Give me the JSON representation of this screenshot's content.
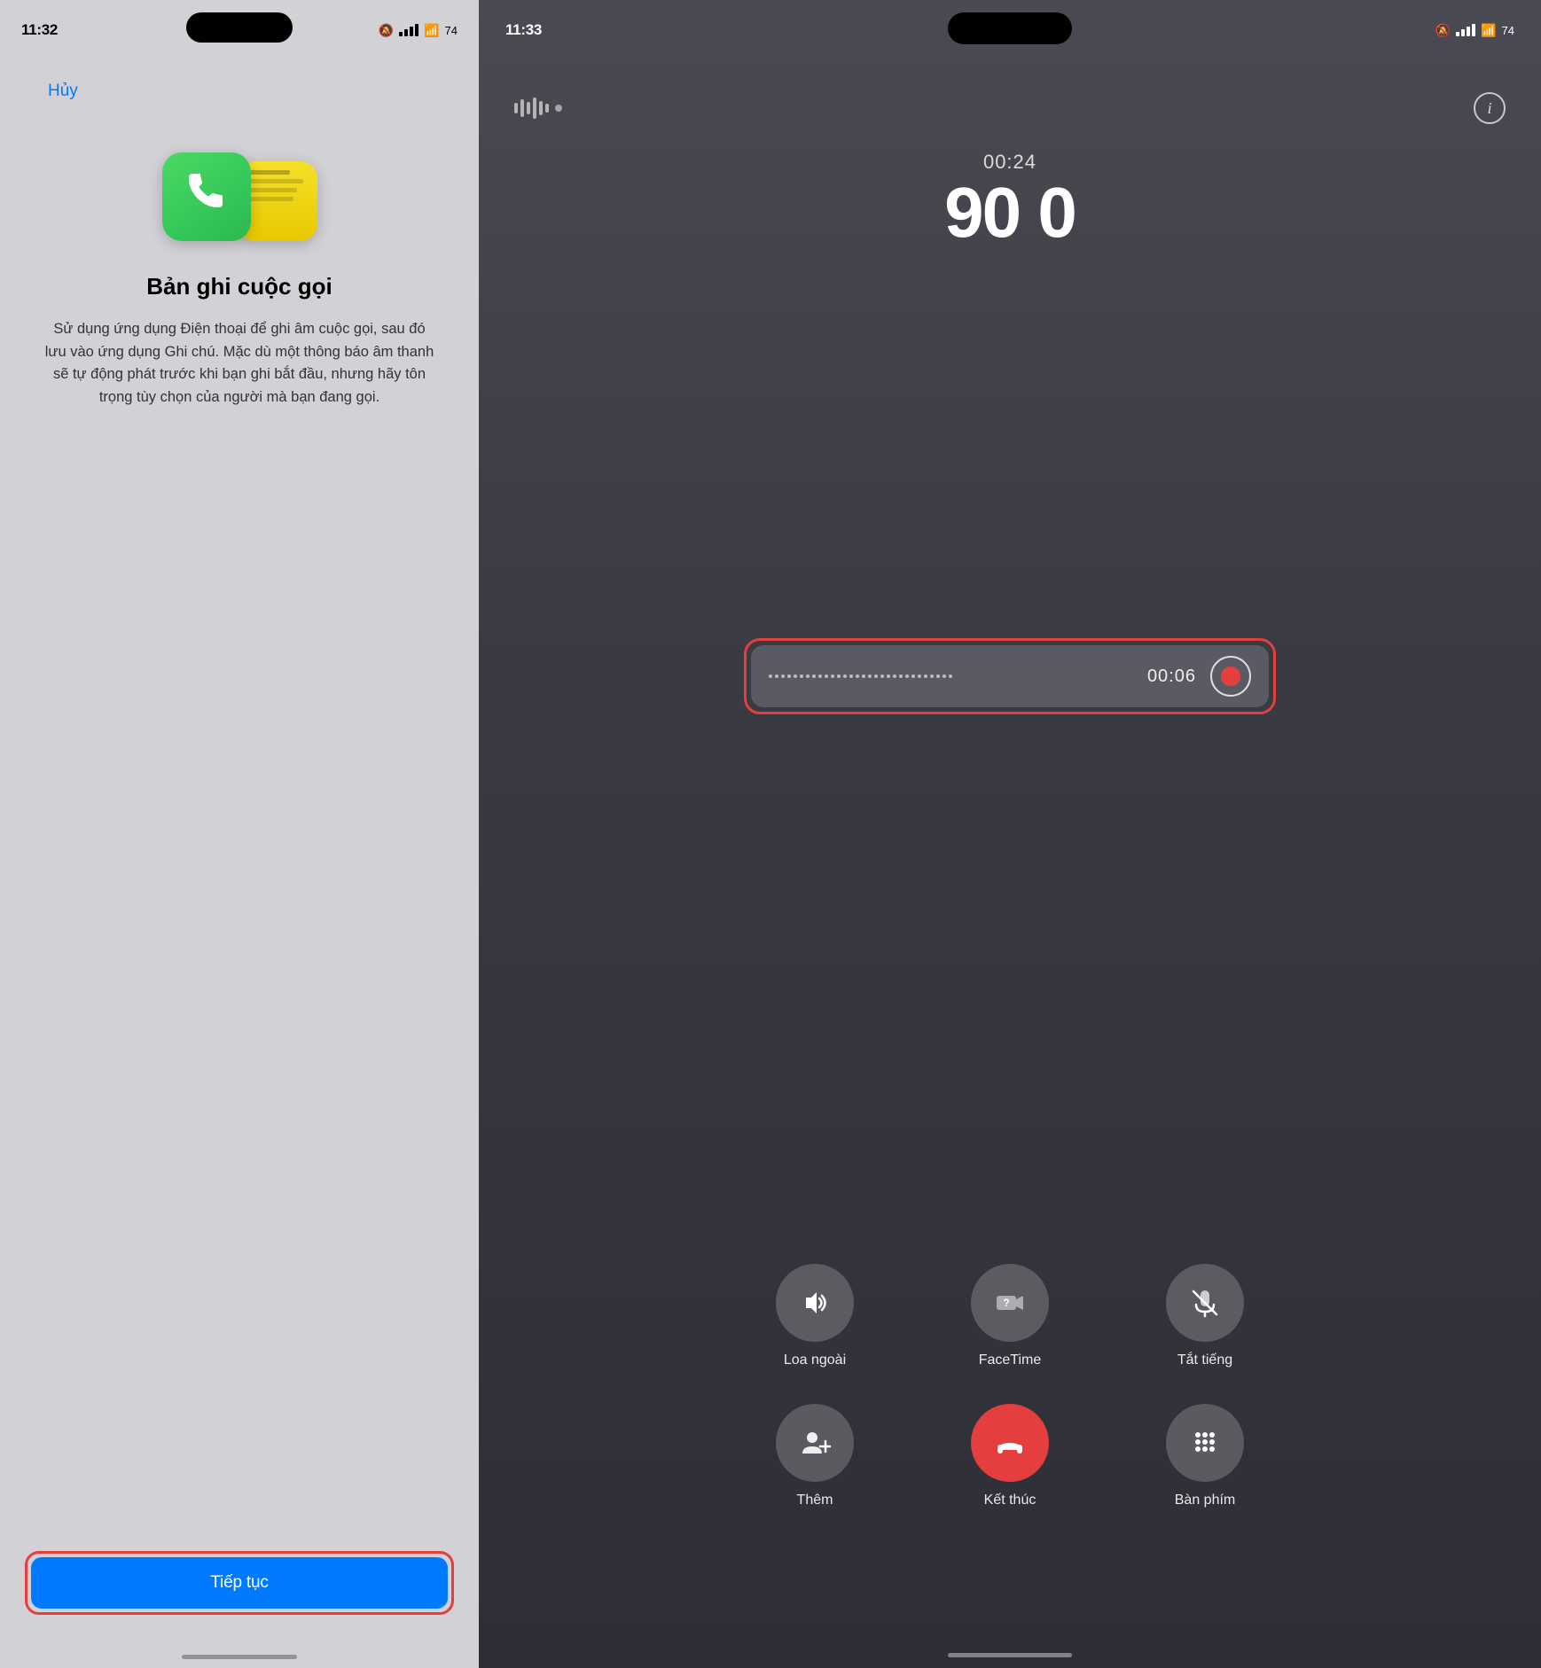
{
  "left": {
    "statusBar": {
      "time": "11:32",
      "bellSlash": "🔕",
      "battery": "74"
    },
    "cancelButton": "Hủy",
    "title": "Bản ghi cuộc gọi",
    "description": "Sử dụng ứng dụng Điện thoại để ghi âm cuộc gọi, sau đó lưu vào ứng dụng Ghi chú. Mặc dù một thông báo âm thanh sẽ tự động phát trước khi bạn ghi bắt đầu, nhưng hãy tôn trọng tùy chọn của người mà bạn đang gọi.",
    "continueButton": "Tiếp tục"
  },
  "right": {
    "statusBar": {
      "time": "11:33",
      "bellSlash": "🔕",
      "battery": "74"
    },
    "callDuration": "00:24",
    "contactName": "90 0",
    "recordingTime": "00:06",
    "controls": [
      {
        "label": "Loa ngoài",
        "icon": "speaker"
      },
      {
        "label": "FaceTime",
        "icon": "facetime"
      },
      {
        "label": "Tắt tiếng",
        "icon": "mute"
      },
      {
        "label": "Thêm",
        "icon": "add-person"
      },
      {
        "label": "Kết thúc",
        "icon": "end-call"
      },
      {
        "label": "Bàn phím",
        "icon": "keypad"
      }
    ]
  }
}
